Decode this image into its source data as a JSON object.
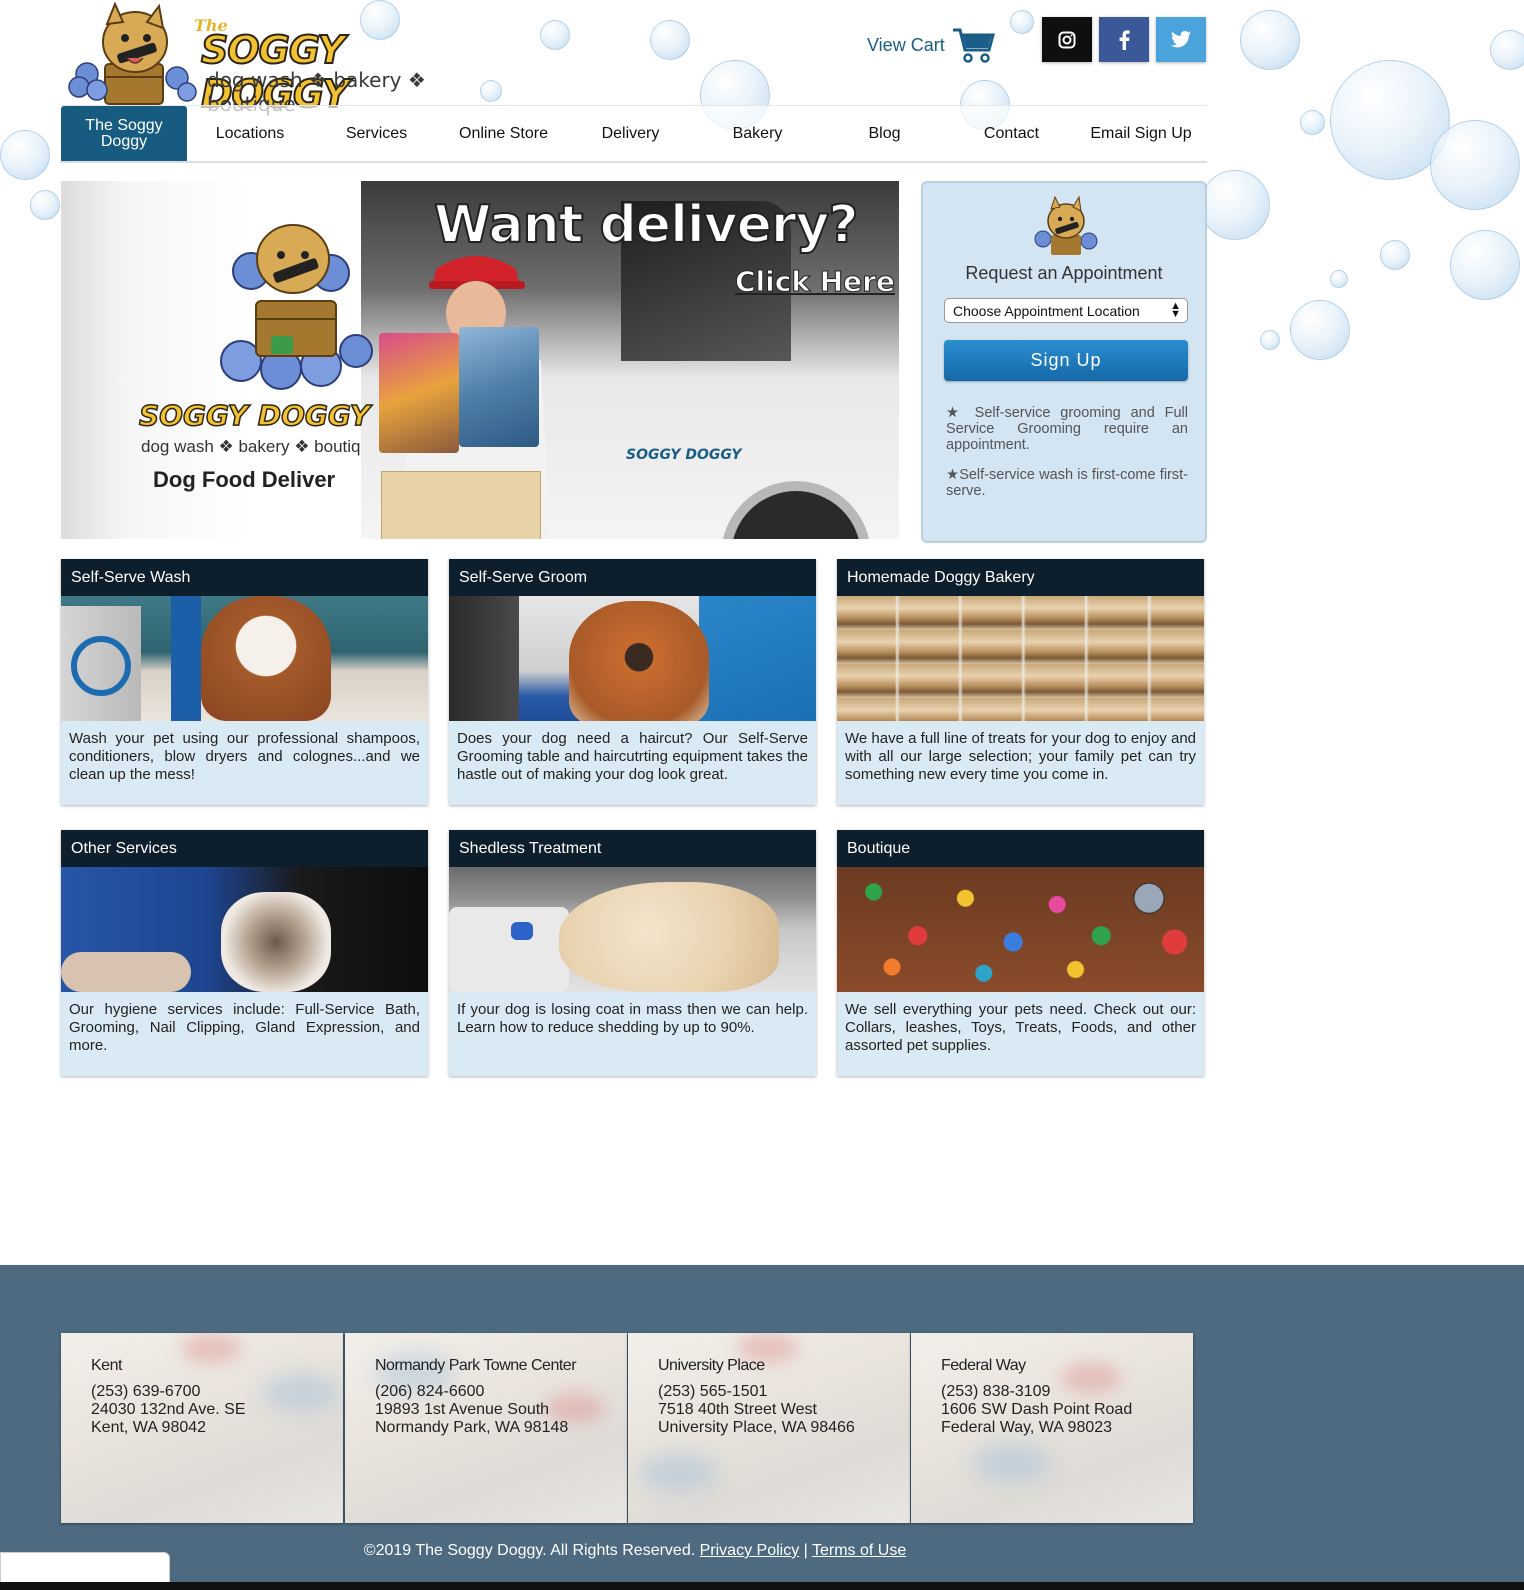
{
  "header": {
    "logo_the": "The",
    "logo_title": "SOGGY DOGGY",
    "logo_tagline": "dog wash ❖ bakery ❖ boutique",
    "cart_label": "View Cart",
    "social": [
      "instagram-icon",
      "facebook-icon",
      "twitter-icon"
    ]
  },
  "nav": {
    "items": [
      {
        "label": "The Soggy Doggy",
        "active": true
      },
      {
        "label": "Locations"
      },
      {
        "label": "Services"
      },
      {
        "label": "Online Store"
      },
      {
        "label": "Delivery"
      },
      {
        "label": "Bakery"
      },
      {
        "label": "Blog"
      },
      {
        "label": "Contact"
      },
      {
        "label": "Email Sign Up"
      }
    ]
  },
  "hero": {
    "title": "Want delivery?",
    "cta": "Click Here",
    "brand": "SOGGY DOGGY",
    "brand_tagline": "dog wash ❖ bakery ❖ boutiq",
    "banner_text": "Dog Food Deliver"
  },
  "appointment": {
    "title": "Request an Appointment",
    "select_value": "Choose Appointment Location",
    "button": "Sign Up",
    "note1": "★ Self-service grooming and Full Service Grooming require an appointment.",
    "note2": "★Self-service wash is first-come first-serve."
  },
  "cards": [
    {
      "title": "Self-Serve Wash",
      "text": "Wash your pet using our professional shampoos, conditioners, blow dryers and colognes...and we clean up the mess!"
    },
    {
      "title": "Self-Serve Groom",
      "text": "Does your dog need a haircut? Our Self-Serve Grooming table and haircutrting equipment takes the hastle out of making your dog look great."
    },
    {
      "title": "Homemade Doggy Bakery",
      "text": "We have a full line of treats for your dog to enjoy and with all our large selection; your family pet can try something new every time you come in."
    },
    {
      "title": "Other Services",
      "text": "Our hygiene services include: Full-Service Bath, Grooming, Nail Clipping, Gland Expression, and more."
    },
    {
      "title": "Shedless Treatment",
      "text": "If your dog is losing coat in mass then we can help. Learn how to reduce shedding by up to 90%."
    },
    {
      "title": "Boutique",
      "text": "We sell everything your pets need. Check out our: Collars, leashes, Toys, Treats, Foods, and other assorted pet supplies."
    }
  ],
  "locations": [
    {
      "name": "Kent",
      "phone": "(253) 639-6700",
      "street": "24030 132nd Ave. SE",
      "city": "Kent, WA 98042"
    },
    {
      "name": "Normandy Park Towne Center",
      "phone": "(206) 824-6600",
      "street": "19893 1st Avenue South",
      "city": "Normandy Park, WA 98148"
    },
    {
      "name": "University Place",
      "phone": "(253) 565-1501",
      "street": "7518 40th Street West",
      "city": "University Place, WA 98466"
    },
    {
      "name": "Federal Way",
      "phone": "(253) 838-3109",
      "street": "1606 SW Dash Point Road",
      "city": "Federal Way, WA 98023"
    }
  ],
  "footer": {
    "copyright": "©2019 The Soggy Doggy. All Rights Reserved.",
    "privacy": "Privacy Policy",
    "separator": "|",
    "terms": "Terms of Use"
  },
  "colors": {
    "brand_blue": "#175b81",
    "dark_header": "#0d1f2d",
    "footer_bg": "#4d6a80",
    "panel_bg": "#d3e5f2"
  }
}
